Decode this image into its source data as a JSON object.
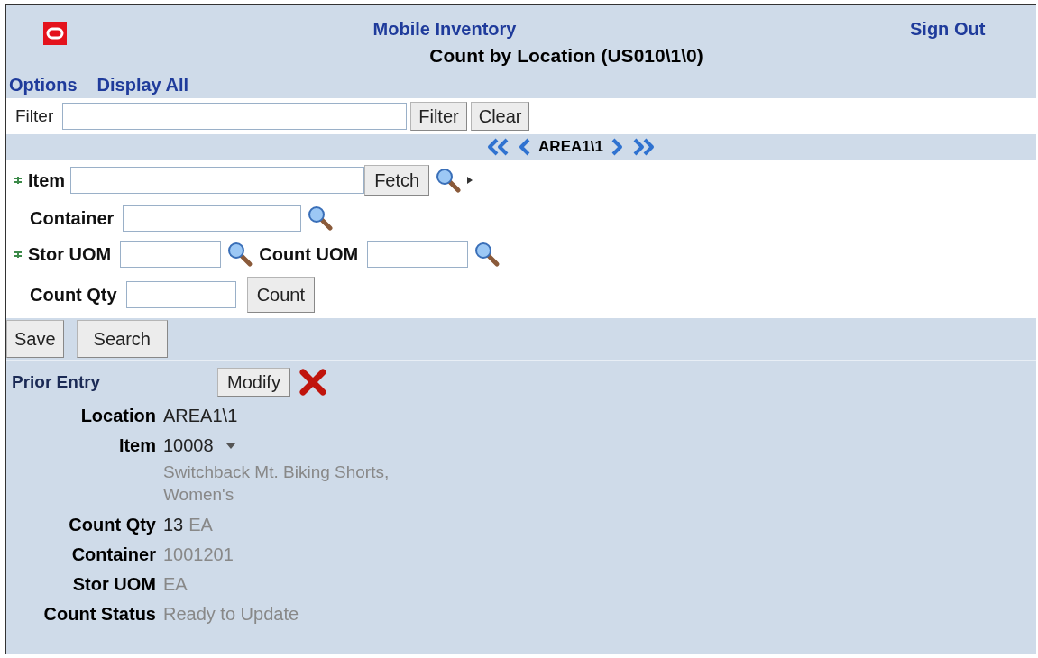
{
  "header": {
    "app_title": "Mobile Inventory",
    "screen_title": "Count by Location (US010\\1\\0)",
    "sign_out": "Sign Out"
  },
  "links": [
    "Options",
    "Display All"
  ],
  "filter": {
    "label": "Filter",
    "buttons": [
      "Filter",
      "Clear"
    ]
  },
  "pager": {
    "location": "AREA1\\1"
  },
  "form": [
    {
      "kind": "item",
      "label": "Item",
      "required": true,
      "button": "Fetch"
    },
    {
      "kind": "lookup",
      "label": "Container",
      "required": false
    },
    {
      "kind": "uom",
      "label": "Stor UOM",
      "required": true,
      "second_label": "Count UOM"
    },
    {
      "kind": "qty",
      "label": "Count Qty",
      "required": false,
      "button": "Count"
    }
  ],
  "actions": [
    "Save",
    "Search"
  ],
  "prior_entry": {
    "title": "Prior Entry",
    "button": "Modify",
    "details": [
      {
        "label": "Location",
        "value": "AREA1\\1",
        "muted": false
      },
      {
        "label": "Item",
        "value": "10008",
        "muted": false,
        "description": "Switchback Mt. Biking Shorts, Women's"
      },
      {
        "label": "Count Qty",
        "value": "13",
        "muted": false,
        "unit": "EA"
      },
      {
        "label": "Container",
        "value": "1001201",
        "muted": true
      },
      {
        "label": "Stor UOM",
        "value": "EA",
        "muted": true
      },
      {
        "label": "Count Status",
        "value": "Ready to Update",
        "muted": true
      }
    ]
  }
}
